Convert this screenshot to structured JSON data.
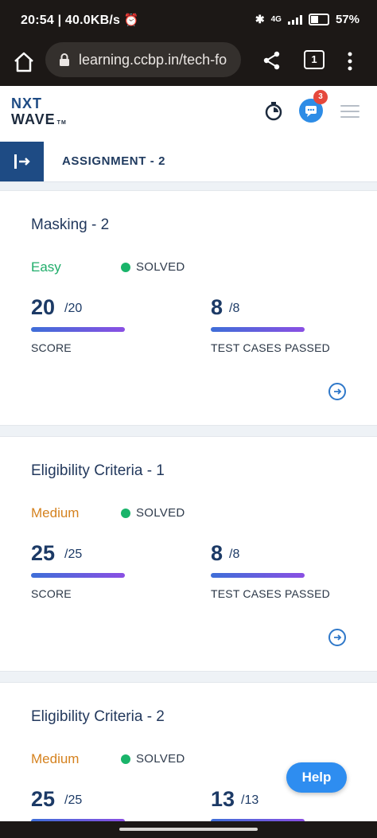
{
  "status_bar": {
    "time_speed": "20:54 | 40.0KB/s",
    "network": "4G",
    "battery": "57%"
  },
  "browser": {
    "url": "learning.ccbp.in/tech-fo",
    "tab_count": "1"
  },
  "header": {
    "logo_line1": "NXT",
    "logo_line2": "WAVE",
    "logo_tm": "TM",
    "chat_badge_count": "3"
  },
  "assignment": {
    "title": "ASSIGNMENT - 2"
  },
  "cards": [
    {
      "title": "Masking - 2",
      "difficulty": "Easy",
      "status": "SOLVED",
      "score_value": "20",
      "score_total": "/20",
      "score_label": "SCORE",
      "tests_value": "8",
      "tests_total": "/8",
      "tests_label": "TEST CASES PASSED"
    },
    {
      "title": "Eligibility Criteria - 1",
      "difficulty": "Medium",
      "status": "SOLVED",
      "score_value": "25",
      "score_total": "/25",
      "score_label": "SCORE",
      "tests_value": "8",
      "tests_total": "/8",
      "tests_label": "TEST CASES PASSED"
    },
    {
      "title": "Eligibility Criteria - 2",
      "difficulty": "Medium",
      "status": "SOLVED",
      "score_value": "25",
      "score_total": "/25",
      "tests_value": "13",
      "tests_total": "/13"
    }
  ],
  "help_label": "Help",
  "colors": {
    "primary_dark": "#1e4b84",
    "easy": "#1fad6a",
    "medium": "#d5821f",
    "solved": "#19b46a",
    "help": "#2e8df0"
  }
}
